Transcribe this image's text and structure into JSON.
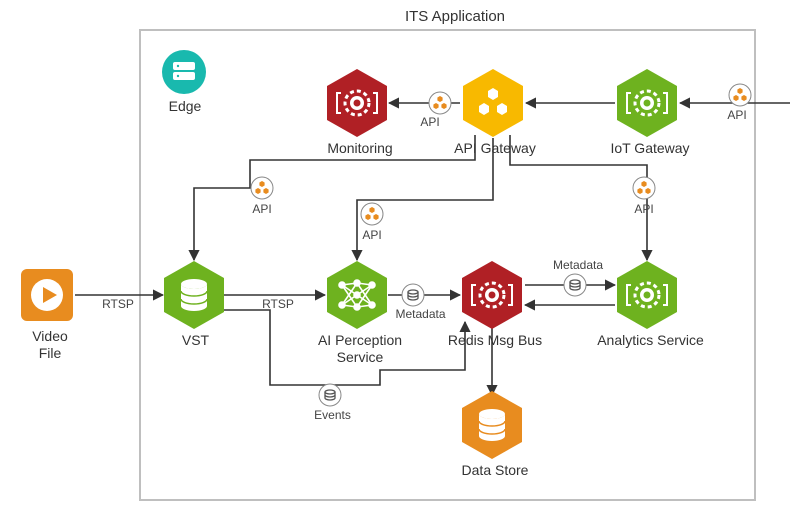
{
  "title": "ITS Application",
  "nodes": {
    "edge": {
      "label": "Edge"
    },
    "videoFile": {
      "label": "Video\nFile"
    },
    "vst": {
      "label": "VST"
    },
    "aiPerception": {
      "label": "AI Perception\nService"
    },
    "redis": {
      "label": "Redis Msg Bus"
    },
    "analytics": {
      "label": "Analytics Service"
    },
    "monitoring": {
      "label": "Monitoring"
    },
    "apiGateway": {
      "label": "API Gateway"
    },
    "iotGateway": {
      "label": "IoT Gateway"
    },
    "dataStore": {
      "label": "Data Store"
    }
  },
  "edgeLabels": {
    "rtsp1": "RTSP",
    "rtsp2": "RTSP",
    "api1": "API",
    "api2": "API",
    "api3": "API",
    "api4": "API",
    "api5": "API",
    "metadata1": "Metadata",
    "metadata2": "Metadata",
    "events": "Events"
  },
  "colors": {
    "green": "#6eb21f",
    "red": "#b02025",
    "orange": "#e88c1f",
    "amber": "#f8b900",
    "teal": "#19b9ae",
    "white": "#ffffff",
    "gray": "#bfbfbf"
  }
}
